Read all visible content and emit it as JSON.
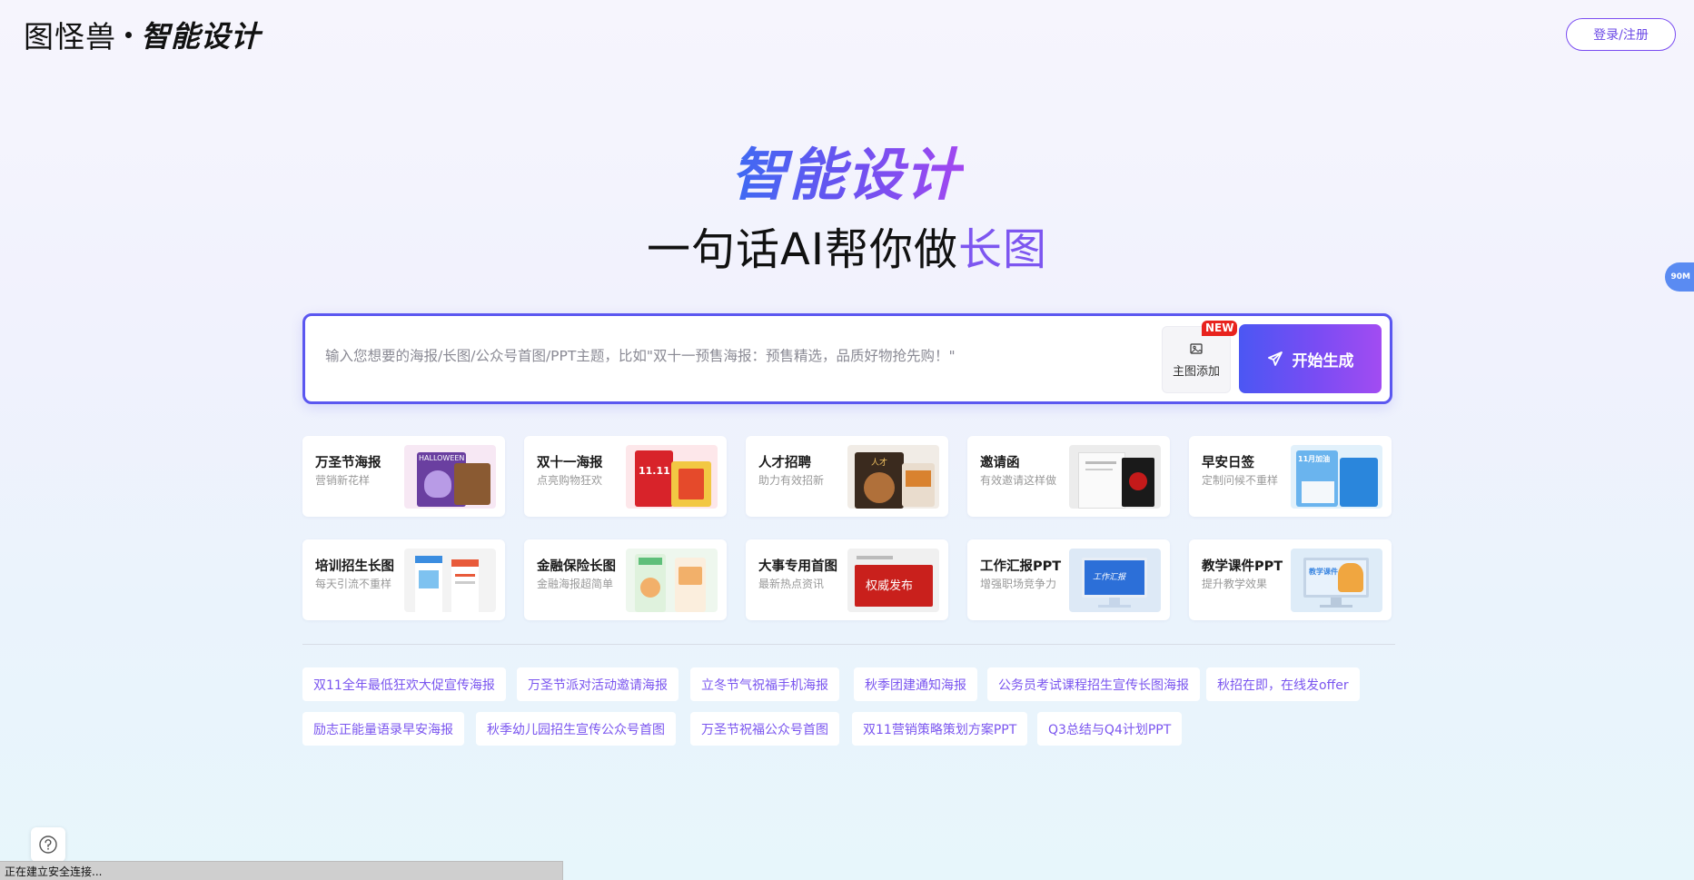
{
  "header": {
    "logo_text": "图怪兽",
    "logo_sub": "智能设计",
    "login_label": "登录/注册"
  },
  "side_badge": "90M",
  "hero": {
    "title": "智能设计",
    "subtitle_prefix": "一句话AI帮你做",
    "subtitle_highlight": "长图"
  },
  "prompt": {
    "placeholder": "输入您想要的海报/长图/公众号首图/PPT主题，比如\"双十一预售海报：预售精选，品质好物抢先购！\"",
    "value": "",
    "upload_label": "主图添加",
    "new_badge": "NEW",
    "generate_label": "开始生成"
  },
  "cards": [
    {
      "title": "万圣节海报",
      "desc": "营销新花样",
      "thumb_colors": [
        "#f7e8f4",
        "#6a3fa0",
        "#d3a96b"
      ]
    },
    {
      "title": "双十一海报",
      "desc": "点亮购物狂欢",
      "thumb_colors": [
        "#fde7ea",
        "#e22a2a",
        "#f4d24a"
      ]
    },
    {
      "title": "人才招聘",
      "desc": "助力有效招新",
      "thumb_colors": [
        "#f1ece6",
        "#3a2a1e",
        "#d9a15a"
      ]
    },
    {
      "title": "邀请函",
      "desc": "有效邀请这样做",
      "thumb_colors": [
        "#ececec",
        "#ffffff",
        "#b81a1a"
      ]
    },
    {
      "title": "早安日签",
      "desc": "定制问候不重样",
      "thumb_colors": [
        "#e2f1fb",
        "#3d9be8",
        "#ffffff"
      ]
    },
    {
      "title": "培训招生长图",
      "desc": "每天引流不重样",
      "thumb_colors": [
        "#f3f3f3",
        "#3b8de0",
        "#e85a3a"
      ]
    },
    {
      "title": "金融保险长图",
      "desc": "金融海报超简单",
      "thumb_colors": [
        "#eef7ee",
        "#5fbf7a",
        "#f2b06a"
      ]
    },
    {
      "title": "大事专用首图",
      "desc": "最新热点资讯",
      "thumb_colors": [
        "#f0f0f0",
        "#c9201c",
        "#ffffff"
      ]
    },
    {
      "title": "工作汇报PPT",
      "desc": "增强职场竞争力",
      "thumb_colors": [
        "#dde9f6",
        "#2c6fd8",
        "#c6d6ea"
      ]
    },
    {
      "title": "教学课件PPT",
      "desc": "提升教学效果",
      "thumb_colors": [
        "#deecf8",
        "#3b86e0",
        "#f0a640"
      ]
    }
  ],
  "thumb_texts": {
    "halloween": "HALLOWEEN",
    "double11": "11.11",
    "recruit": "人才",
    "press": "权威发布",
    "morning": "11月加油",
    "report": "工作汇报",
    "lesson": "教学课件"
  },
  "tags": [
    "双11全年最低狂欢大促宣传海报",
    "万圣节派对活动邀请海报",
    "立冬节气祝福手机海报",
    "秋季团建通知海报",
    "公务员考试课程招生宣传长图海报",
    "秋招在即，在线发offer",
    "励志正能量语录早安海报",
    "秋季幼儿园招生宣传公众号首图",
    "万圣节祝福公众号首图",
    "双11营销策略策划方案PPT",
    "Q3总结与Q4计划PPT"
  ],
  "status_bar": "正在建立安全连接...",
  "colors": {
    "accent": "#7a4cf1",
    "accent_blue": "#4b57f3",
    "tag_text": "#7a55ef"
  }
}
